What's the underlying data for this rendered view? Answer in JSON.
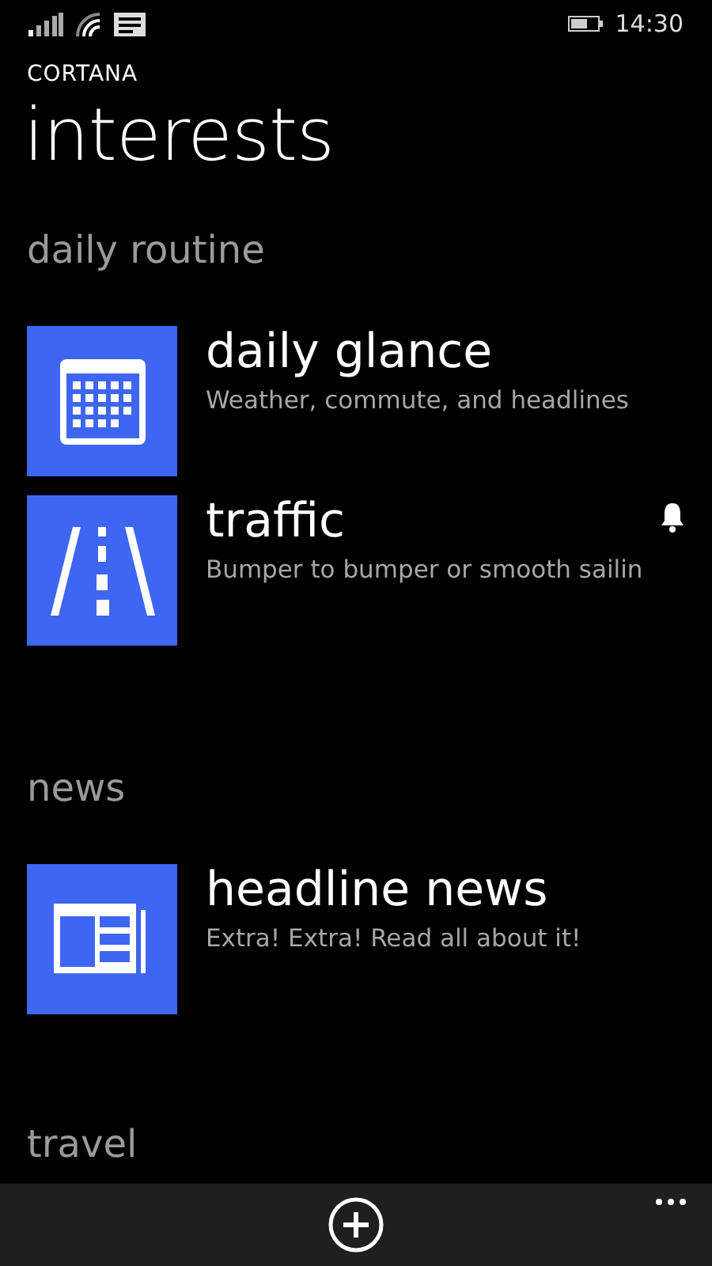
{
  "status_bar": {
    "time": "14:30"
  },
  "app_name": "CORTANA",
  "page_title": "interests",
  "sections": [
    {
      "title": "daily routine",
      "items": [
        {
          "kind": "calendar",
          "title": "daily glance",
          "subtitle": "Weather, commute, and headlines",
          "alert": false
        },
        {
          "kind": "road",
          "title": "traffic",
          "subtitle": "Bumper to bumper or smooth sailin",
          "alert": true
        }
      ]
    },
    {
      "title": "news",
      "items": [
        {
          "kind": "newspaper",
          "title": "headline news",
          "subtitle": "Extra! Extra! Read all about it!",
          "alert": false
        }
      ]
    },
    {
      "title": "travel"
    }
  ],
  "app_bar": {
    "buttons": [
      {
        "kind": "add"
      }
    ]
  }
}
